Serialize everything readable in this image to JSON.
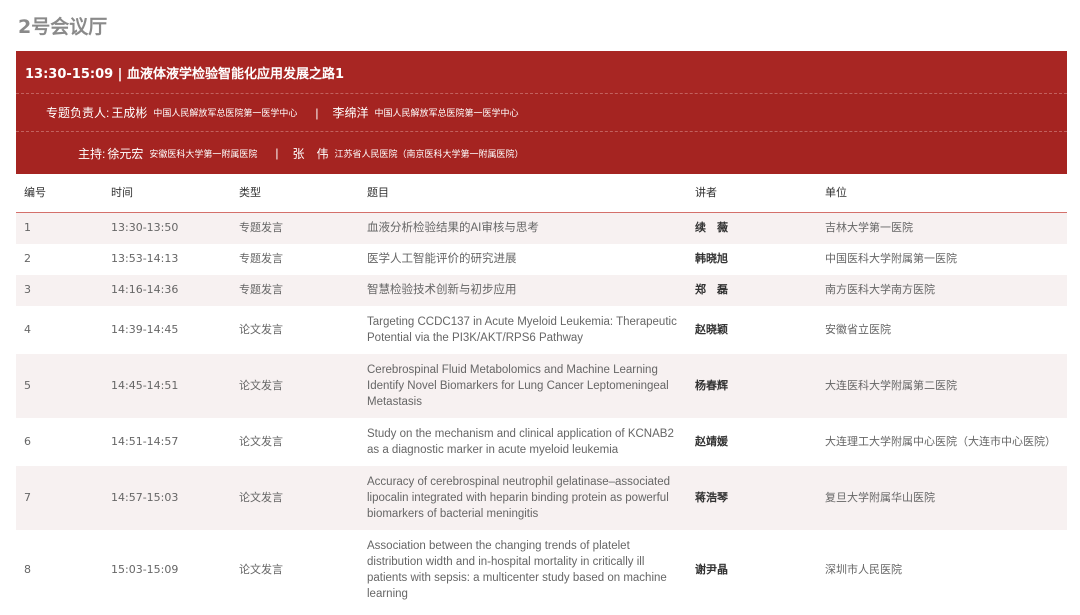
{
  "hall": {
    "title": "2号会议厅"
  },
  "session": {
    "title": "13:30-15:09 | 血液体液学检验智能化应用发展之路1",
    "leads": {
      "role": "专题负责人:",
      "people": [
        {
          "name": "王成彬",
          "org": "中国人民解放军总医院第一医学中心"
        },
        {
          "name": "李绵洋",
          "org": "中国人民解放军总医院第一医学中心"
        }
      ],
      "separator": "|"
    },
    "hosts": {
      "role": "主持:",
      "people": [
        {
          "name": "徐元宏",
          "org": "安徽医科大学第一附属医院"
        },
        {
          "name": "张　伟",
          "org": "江苏省人民医院（南京医科大学第一附属医院）"
        }
      ],
      "separator": "|"
    }
  },
  "table": {
    "headers": {
      "no": "编号",
      "time": "时间",
      "type": "类型",
      "topic": "题目",
      "speaker": "讲者",
      "unit": "单位"
    },
    "rows": [
      {
        "no": "1",
        "time": "13:30-13:50",
        "type": "专题发言",
        "topic": "血液分析检验结果的AI审核与思考",
        "speaker": "续　薇",
        "unit": "吉林大学第一医院"
      },
      {
        "no": "2",
        "time": "13:53-14:13",
        "type": "专题发言",
        "topic": "医学人工智能评价的研究进展",
        "speaker": "韩晓旭",
        "unit": "中国医科大学附属第一医院"
      },
      {
        "no": "3",
        "time": "14:16-14:36",
        "type": "专题发言",
        "topic": "智慧检验技术创新与初步应用",
        "speaker": "郑　磊",
        "unit": "南方医科大学南方医院"
      },
      {
        "no": "4",
        "time": "14:39-14:45",
        "type": "论文发言",
        "topic": "Targeting CCDC137 in Acute Myeloid Leukemia: Therapeutic Potential via the PI3K/AKT/RPS6 Pathway",
        "speaker": "赵晓颖",
        "unit": "安徽省立医院"
      },
      {
        "no": "5",
        "time": "14:45-14:51",
        "type": "论文发言",
        "topic": "Cerebrospinal Fluid Metabolomics and Machine Learning Identify Novel Biomarkers for Lung Cancer Leptomeningeal Metastasis",
        "speaker": "杨春辉",
        "unit": "大连医科大学附属第二医院"
      },
      {
        "no": "6",
        "time": "14:51-14:57",
        "type": "论文发言",
        "topic": "Study on the mechanism and clinical application of KCNAB2 as a diagnostic marker in acute myeloid leukemia",
        "speaker": "赵靖媛",
        "unit": "大连理工大学附属中心医院（大连市中心医院）"
      },
      {
        "no": "7",
        "time": "14:57-15:03",
        "type": "论文发言",
        "topic": "Accuracy of cerebrospinal neutrophil gelatinase–associated lipocalin integrated with heparin binding protein as powerful biomarkers of bacterial meningitis",
        "speaker": "蒋浩琴",
        "unit": "复旦大学附属华山医院"
      },
      {
        "no": "8",
        "time": "15:03-15:09",
        "type": "论文发言",
        "topic": "Association between the changing trends of platelet distribution width and in-hospital mortality in critically ill patients with sepsis: a multicenter study based on machine learning",
        "speaker": "谢尹晶",
        "unit": "深圳市人民医院"
      }
    ]
  }
}
